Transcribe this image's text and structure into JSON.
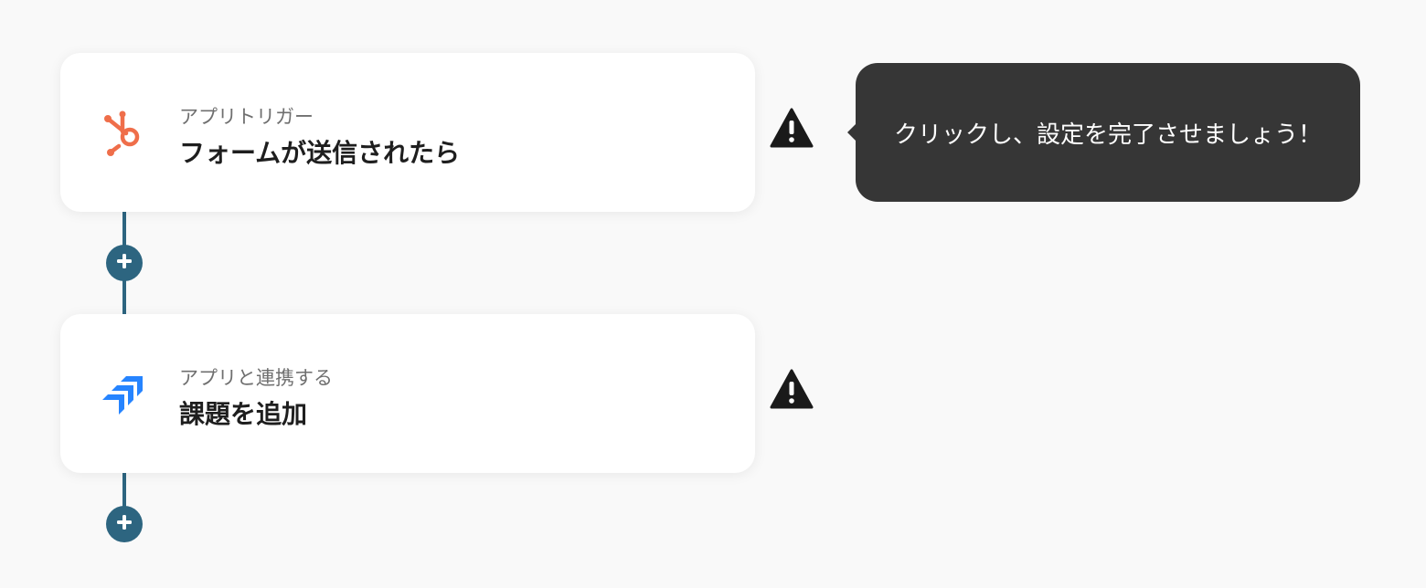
{
  "flow": {
    "steps": [
      {
        "kind": "trigger",
        "app_icon": "hubspot-icon",
        "subtitle": "アプリトリガー",
        "title": "フォームが送信されたら",
        "status_icon": "warning-icon"
      },
      {
        "kind": "action",
        "app_icon": "jira-icon",
        "subtitle": "アプリと連携する",
        "title": "課題を追加",
        "status_icon": "warning-icon"
      }
    ],
    "add_step_icon": "plus-icon"
  },
  "tooltip": {
    "text": "クリックし、設定を完了させましょう！"
  },
  "colors": {
    "background": "#f9f9f9",
    "connector": "#2d6580",
    "hubspot": "#ef6e4a",
    "jira": "#2684ff",
    "tooltip_bg": "#363636",
    "warning": "#1a1a1a"
  }
}
